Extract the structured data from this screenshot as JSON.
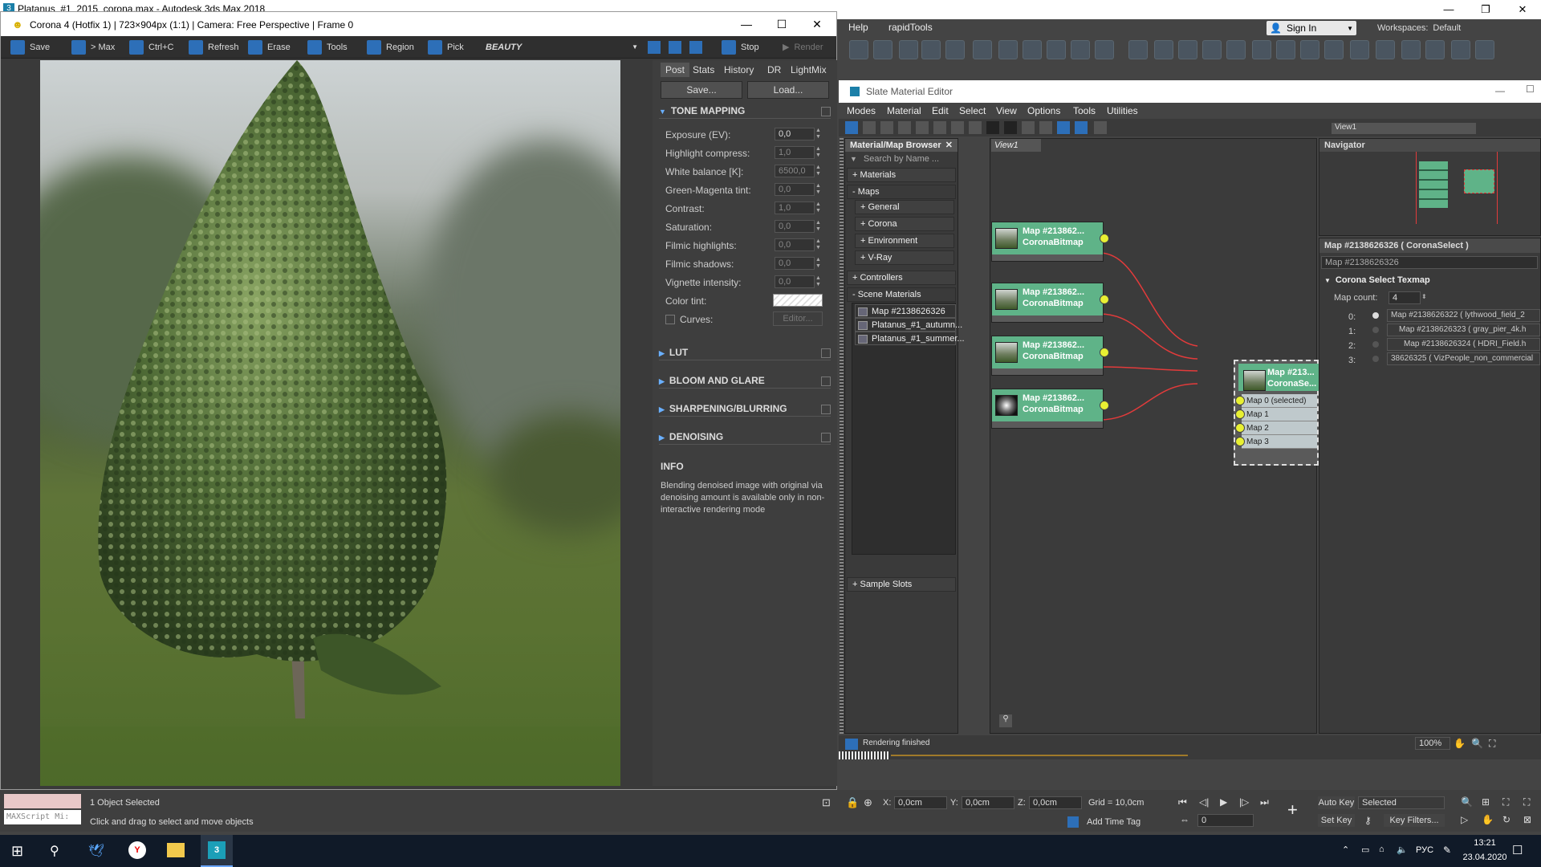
{
  "app": {
    "title": "Platanus_#1_2015_corona.max - Autodesk 3ds Max 2018",
    "window_buttons": [
      "—",
      "❐",
      "✕"
    ]
  },
  "main_menu": {
    "help": "Help",
    "rapidtools": "rapidTools",
    "sign_in": "Sign In",
    "workspaces_label": "Workspaces:",
    "workspaces_value": "Default"
  },
  "vfb": {
    "title": "Corona 4 (Hotfix 1) | 723×904px (1:1) | Camera: Free Perspective | Frame 0",
    "window_buttons": [
      "—",
      "☐",
      "✕"
    ],
    "toolbar": {
      "save": "Save",
      "to_max": "> Max",
      "copy": "Ctrl+C",
      "refresh": "Refresh",
      "erase": "Erase",
      "tools": "Tools",
      "region": "Region",
      "pick": "Pick",
      "channel": "BEAUTY",
      "stop": "Stop",
      "render": "Render"
    },
    "tabs": [
      "Post",
      "Stats",
      "History",
      "DR",
      "LightMix"
    ],
    "save_btn": "Save...",
    "load_btn": "Load...",
    "tone_mapping": {
      "header": "TONE MAPPING",
      "rows": [
        {
          "label": "Exposure (EV):",
          "value": "0,0"
        },
        {
          "label": "Highlight compress:",
          "value": "1,0"
        },
        {
          "label": "White balance [K]:",
          "value": "6500,0"
        },
        {
          "label": "Green-Magenta tint:",
          "value": "0,0"
        },
        {
          "label": "Contrast:",
          "value": "1,0"
        },
        {
          "label": "Saturation:",
          "value": "0,0"
        },
        {
          "label": "Filmic highlights:",
          "value": "0,0"
        },
        {
          "label": "Filmic shadows:",
          "value": "0,0"
        },
        {
          "label": "Vignette intensity:",
          "value": "0,0"
        }
      ],
      "color_tint": "Color tint:",
      "curves": "Curves:",
      "editor": "Editor..."
    },
    "sections": [
      "LUT",
      "BLOOM AND GLARE",
      "SHARPENING/BLURRING",
      "DENOISING"
    ],
    "info_header": "INFO",
    "info_text": "Blending denoised image with original via denoising amount is available only in non-interactive rendering mode"
  },
  "sme": {
    "title": "Slate Material Editor",
    "menu": [
      "Modes",
      "Material",
      "Edit",
      "Select",
      "View",
      "Options",
      "Tools",
      "Utilities"
    ],
    "view_label": "View1",
    "browser": {
      "title": "Material/Map Browser",
      "search_placeholder": "Search by Name ...",
      "materials": "+ Materials",
      "maps": "- Maps",
      "general": "+ General",
      "corona": "+ Corona",
      "environment": "+ Environment",
      "vray": "+ V-Ray",
      "controllers": "+ Controllers",
      "scene_materials": "- Scene Materials",
      "scene_items": [
        "Map #2138626326  (...",
        "Platanus_#1_autumn...",
        "Platanus_#1_summer..."
      ],
      "sample_slots": "+ Sample Slots"
    },
    "view_tab": "View1",
    "nodes": [
      {
        "title": "Map #213862...",
        "subtitle": "CoronaBitmap"
      },
      {
        "title": "Map #213862...",
        "subtitle": "CoronaBitmap"
      },
      {
        "title": "Map #213862...",
        "subtitle": "CoronaBitmap"
      },
      {
        "title": "Map #213862...",
        "subtitle": "CoronaBitmap"
      }
    ],
    "select_node": {
      "title": "Map #213...",
      "subtitle": "CoronaSe...",
      "slots": [
        "Map 0 (selected)",
        "Map 1",
        "Map 2",
        "Map 3"
      ]
    },
    "navigator": "Navigator",
    "props": {
      "header": "Map #2138626326  ( CoronaSelect )",
      "name_field": "Map #2138626326",
      "rollout": "Corona Select Texmap",
      "map_count_label": "Map count:",
      "map_count": "4",
      "maps": [
        {
          "idx": "0:",
          "name": "Map #2138626322 ( lythwood_field_2"
        },
        {
          "idx": "1:",
          "name": "Map #2138626323 ( gray_pier_4k.h"
        },
        {
          "idx": "2:",
          "name": "Map #2138626324 ( HDRI_Field.h"
        },
        {
          "idx": "3:",
          "name": "38626325 ( VizPeople_non_commercial"
        }
      ]
    },
    "status": "Rendering finished",
    "zoom": "100%"
  },
  "statusbar": {
    "selection": "1 Object Selected",
    "hint": "Click and drag to select and move objects",
    "script": "MAXScript Mi:",
    "x_label": "X:",
    "x_value": "0,0cm",
    "y_label": "Y:",
    "y_value": "0,0cm",
    "z_label": "Z:",
    "z_value": "0,0cm",
    "grid": "Grid = 10,0cm",
    "add_time_tag": "Add Time Tag",
    "auto_key": "Auto Key",
    "set_key": "Set Key",
    "selected": "Selected",
    "key_filters": "Key Filters...",
    "frame": "0"
  },
  "taskbar": {
    "lang": "РУС",
    "time": "13:21",
    "date": "23.04.2020"
  }
}
